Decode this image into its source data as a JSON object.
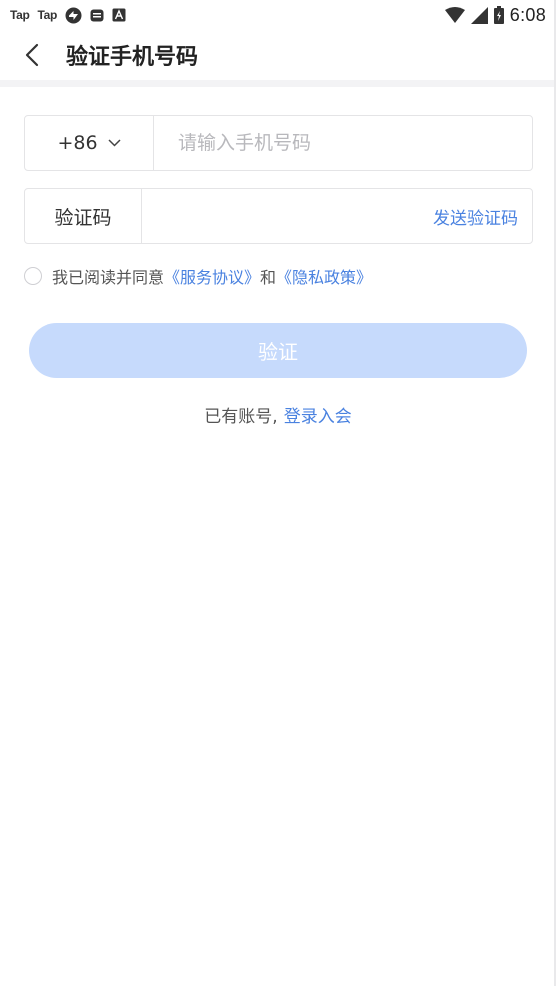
{
  "status_bar": {
    "app_icons": [
      "Tap",
      "Tap"
    ],
    "time": "6:08"
  },
  "header": {
    "title": "验证手机号码",
    "back_icon": "chevron-left-icon"
  },
  "phone_field": {
    "country_code": "+86",
    "placeholder": "请输入手机号码",
    "value": ""
  },
  "code_field": {
    "label": "验证码",
    "value": "",
    "send_code_label": "发送验证码"
  },
  "agreement": {
    "prefix": "我已阅读并同意",
    "service_link": "《服务协议》",
    "conjunction": "和",
    "privacy_link": "《隐私政策》",
    "checked": false
  },
  "verify_button": {
    "label": "验证",
    "color": "#c6dafc"
  },
  "login": {
    "prefix": "已有账号,",
    "link": "登录入会"
  },
  "colors": {
    "accent": "#4a82e0",
    "border": "#e4e4e6"
  }
}
